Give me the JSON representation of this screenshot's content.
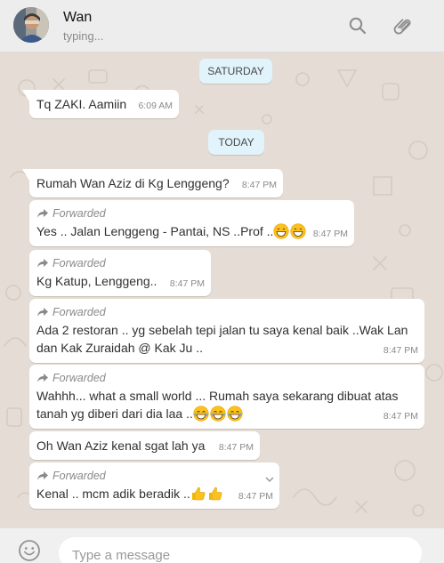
{
  "header": {
    "contact_name": "Wan",
    "status": "typing..."
  },
  "dates": {
    "previous": "SATURDAY",
    "today": "TODAY"
  },
  "messages": [
    {
      "forwarded": false,
      "text": "Tq ZAKI. Aamiin",
      "time": "6:09 AM"
    },
    {
      "forwarded": false,
      "text": "Rumah Wan Aziz di Kg Lenggeng?",
      "time": "8:47 PM"
    },
    {
      "forwarded": true,
      "text": "Yes .. Jalan Lenggeng - Pantai, NS ..Prof ..",
      "emoji": [
        "grin-emoji",
        "grin-emoji"
      ],
      "time": "8:47 PM"
    },
    {
      "forwarded": true,
      "text": "Kg Katup, Lenggeng..",
      "time": "8:47 PM"
    },
    {
      "forwarded": true,
      "text": "Ada 2 restoran .. yg sebelah tepi jalan tu saya kenal baik ..Wak Lan dan Kak Zuraidah @ Kak Ju ..",
      "time": "8:47 PM"
    },
    {
      "forwarded": true,
      "text": "Wahhh... what a small world ... Rumah saya sekarang dibuat atas tanah yg diberi dari dia laa ..",
      "emoji": [
        "tears-of-joy-emoji",
        "tears-of-joy-emoji",
        "tears-of-joy-emoji"
      ],
      "time": "8:47 PM"
    },
    {
      "forwarded": false,
      "text": "Oh Wan Aziz kenal sgat lah ya",
      "time": "8:47 PM"
    },
    {
      "forwarded": true,
      "text": "Kenal .. mcm adik beradik ..",
      "emoji": [
        "thumbs-up-emoji",
        "thumbs-up-emoji"
      ],
      "time": "8:47 PM"
    }
  ],
  "forwarded_label": "Forwarded",
  "composer": {
    "placeholder": "Type a message"
  },
  "colors": {
    "chat_bg": "#e5ddd5",
    "bubble": "#ffffff",
    "day_pill": "#e1f3fb",
    "header_bg": "#ededed"
  }
}
